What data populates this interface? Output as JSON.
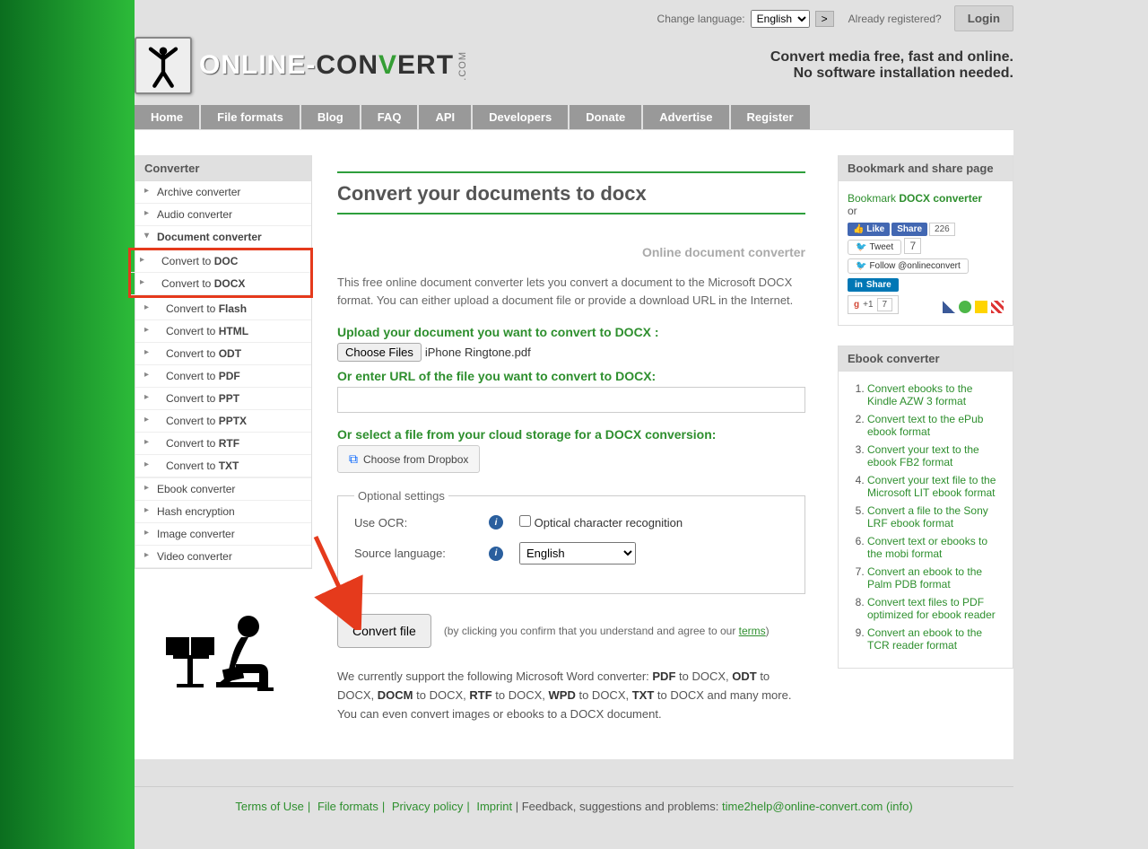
{
  "topbar": {
    "change_lang_label": "Change language:",
    "lang_selected": "English",
    "go": ">",
    "registered_label": "Already registered?",
    "login": "Login"
  },
  "logo": {
    "online": "ONLINE-",
    "con": "CON",
    "v": "V",
    "ert": "ERT",
    "com": ".COM"
  },
  "tagline1": "Convert media free, fast and online.",
  "tagline2": "No software installation needed.",
  "nav": [
    "Home",
    "File formats",
    "Blog",
    "FAQ",
    "API",
    "Developers",
    "Donate",
    "Advertise",
    "Register"
  ],
  "sidebar": {
    "title": "Converter",
    "items": [
      {
        "label": "Archive converter"
      },
      {
        "label": "Audio converter"
      },
      {
        "label": "Document converter",
        "expanded": true,
        "children": [
          {
            "pre": "Convert to ",
            "fmt": "DOC"
          },
          {
            "pre": "Convert to ",
            "fmt": "DOCX"
          },
          {
            "pre": "Convert to ",
            "fmt": "Flash"
          },
          {
            "pre": "Convert to ",
            "fmt": "HTML"
          },
          {
            "pre": "Convert to ",
            "fmt": "ODT"
          },
          {
            "pre": "Convert to ",
            "fmt": "PDF"
          },
          {
            "pre": "Convert to ",
            "fmt": "PPT"
          },
          {
            "pre": "Convert to ",
            "fmt": "PPTX"
          },
          {
            "pre": "Convert to ",
            "fmt": "RTF"
          },
          {
            "pre": "Convert to ",
            "fmt": "TXT"
          }
        ]
      },
      {
        "label": "Ebook converter"
      },
      {
        "label": "Hash encryption"
      },
      {
        "label": "Image converter"
      },
      {
        "label": "Video converter"
      }
    ]
  },
  "main": {
    "h1": "Convert your documents to docx",
    "subtitle": "Online document converter",
    "desc": "This free online document converter lets you convert a document to the Microsoft DOCX format. You can either upload a document file or provide a download URL in the Internet.",
    "upload_label": "Upload your document you want to convert to DOCX :",
    "choose_files": "Choose Files",
    "file_selected": "iPhone Ringtone.pdf",
    "url_label": "Or enter URL of the file you want to convert to DOCX:",
    "cloud_label": "Or select a file from your cloud storage for a DOCX conversion:",
    "dropbox": "Choose from Dropbox",
    "optional_legend": "Optional settings",
    "ocr_label": "Use OCR:",
    "ocr_check": "Optical character recognition",
    "srclang_label": "Source language:",
    "srclang_selected": "English",
    "convert_btn": "Convert file",
    "confirm1": "(by clicking you confirm that you understand and agree to our ",
    "terms": "terms",
    "confirm2": ")",
    "supported1": "We currently support the following Microsoft Word converter: ",
    "supported2": " to DOCX, ",
    "supported3": " to DOCX, ",
    "supported4": " to DOCX, ",
    "supported5": " to DOCX, ",
    "supported6": " to DOCX, ",
    "supported7": " to DOCX and many more. You can even convert images or ebooks to a DOCX document.",
    "s_pdf": "PDF",
    "s_odt": "ODT",
    "s_docm": "DOCM",
    "s_rtf": "RTF",
    "s_wpd": "WPD",
    "s_txt": "TXT"
  },
  "rcol": {
    "bookmark_title": "Bookmark and share page",
    "bookmark_pre": "Bookmark ",
    "bookmark_link": "DOCX converter",
    "or": "or",
    "fb_like": "Like",
    "fb_share": "Share",
    "fb_count": "226",
    "tw_tweet": "Tweet",
    "tw_count": "7",
    "tw_follow": "Follow @onlineconvert",
    "in_share": "Share",
    "gplus": "+1",
    "gcount": "7",
    "ebook_title": "Ebook converter",
    "ebooks": [
      "Convert ebooks to the Kindle AZW 3 format",
      "Convert text to the ePub ebook format",
      "Convert your text to the ebook FB2 format",
      "Convert your text file to the Microsoft LIT ebook format",
      "Convert a file to the Sony LRF ebook format",
      "Convert text or ebooks to the mobi format",
      "Convert an ebook to the Palm PDB format",
      "Convert text files to PDF optimized for ebook reader",
      "Convert an ebook to the TCR reader format"
    ]
  },
  "footer": {
    "terms": "Terms of Use",
    "formats": "File formats",
    "privacy": "Privacy policy",
    "imprint": "Imprint",
    "feedback": " | Feedback, suggestions and problems: ",
    "email": "time2help@online-convert.com",
    "info": " (info)"
  }
}
